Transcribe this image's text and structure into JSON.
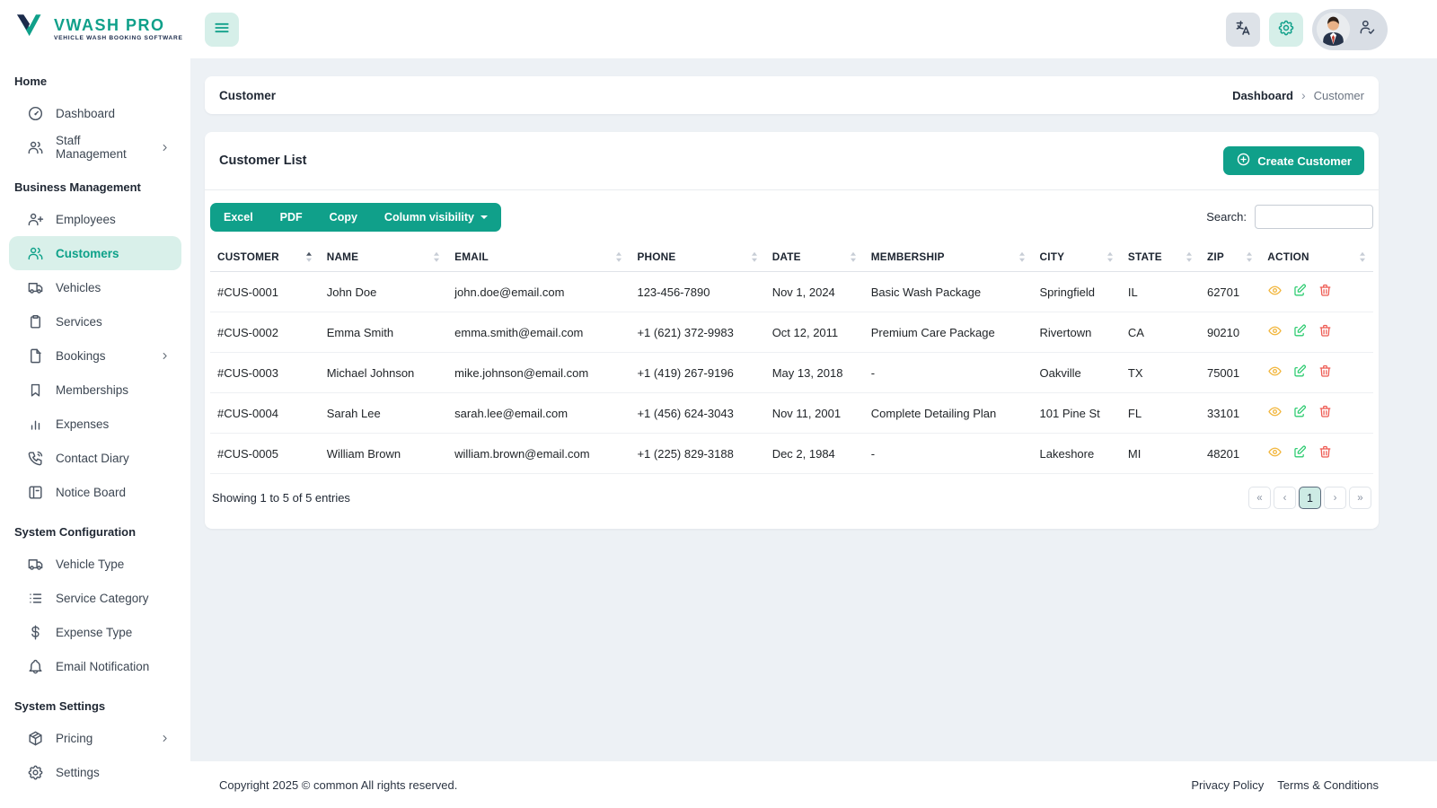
{
  "brand": {
    "name": "VWASH PRO",
    "tagline": "VEHICLE WASH BOOKING SOFTWARE",
    "mark_icon": "vwash-logo-mark"
  },
  "topbar": {
    "menu_icon": "menu-icon",
    "action_icons": [
      "translate-icon",
      "gear-icon"
    ],
    "profile_icons": [
      "avatar",
      "user-check-icon"
    ]
  },
  "sidebar": {
    "sections": [
      {
        "title": "Home",
        "items": [
          {
            "label": "Dashboard",
            "icon": "dashboard-icon"
          },
          {
            "label": "Staff Management",
            "icon": "users-icon",
            "chevron": true
          }
        ]
      },
      {
        "title": "Business Management",
        "items": [
          {
            "label": "Employees",
            "icon": "user-plus-icon"
          },
          {
            "label": "Customers",
            "icon": "users-icon",
            "active": true
          },
          {
            "label": "Vehicles",
            "icon": "truck-icon"
          },
          {
            "label": "Services",
            "icon": "clipboard-icon"
          },
          {
            "label": "Bookings",
            "icon": "file-icon",
            "chevron": true
          },
          {
            "label": "Memberships",
            "icon": "bookmark-icon"
          },
          {
            "label": "Expenses",
            "icon": "chart-bar-icon"
          },
          {
            "label": "Contact Diary",
            "icon": "phone-icon"
          },
          {
            "label": "Notice Board",
            "icon": "notice-board-icon"
          }
        ]
      },
      {
        "title": "System Configuration",
        "items": [
          {
            "label": "Vehicle Type",
            "icon": "truck-icon"
          },
          {
            "label": "Service Category",
            "icon": "list-icon"
          },
          {
            "label": "Expense Type",
            "icon": "dollar-icon"
          },
          {
            "label": "Email Notification",
            "icon": "bell-icon"
          }
        ]
      },
      {
        "title": "System Settings",
        "items": [
          {
            "label": "Pricing",
            "icon": "package-icon",
            "chevron": true
          },
          {
            "label": "Settings",
            "icon": "gear-icon"
          }
        ]
      }
    ]
  },
  "page_header": {
    "title": "Customer",
    "breadcrumb": [
      {
        "label": "Dashboard"
      },
      {
        "label": "Customer"
      }
    ],
    "separator": "›"
  },
  "customer_list": {
    "title": "Customer List",
    "create_button_label": "Create Customer",
    "export_buttons": [
      "Excel",
      "PDF",
      "Copy"
    ],
    "column_visibility_label": "Column visibility",
    "search": {
      "label": "Search:",
      "value": ""
    },
    "table": {
      "columns": [
        "CUSTOMER",
        "NAME",
        "EMAIL",
        "PHONE",
        "DATE",
        "MEMBERSHIP",
        "CITY",
        "STATE",
        "ZIP",
        "ACTION"
      ],
      "sorted_column": "CUSTOMER",
      "sort_direction": "asc",
      "rows": [
        [
          "#CUS-0001",
          "John Doe",
          "john.doe@email.com",
          "123-456-7890",
          "Nov 1, 2024",
          "Basic Wash Package",
          "Springfield",
          "IL",
          "62701"
        ],
        [
          "#CUS-0002",
          "Emma Smith",
          "emma.smith@email.com",
          "+1 (621) 372-9983",
          "Oct 12, 2011",
          "Premium Care Package",
          "Rivertown",
          "CA",
          "90210"
        ],
        [
          "#CUS-0003",
          "Michael Johnson",
          "mike.johnson@email.com",
          "+1 (419) 267-9196",
          "May 13, 2018",
          "-",
          "Oakville",
          "TX",
          "75001"
        ],
        [
          "#CUS-0004",
          "Sarah Lee",
          "sarah.lee@email.com",
          "+1 (456) 624-3043",
          "Nov 11, 2001",
          "Complete Detailing Plan",
          "101 Pine St",
          "FL",
          "33101"
        ],
        [
          "#CUS-0005",
          "William Brown",
          "william.brown@email.com",
          "+1 (225) 829-3188",
          "Dec 2, 1984",
          "-",
          "Lakeshore",
          "MI",
          "48201"
        ]
      ],
      "row_actions": [
        "view",
        "edit",
        "delete"
      ]
    },
    "summary": "Showing 1 to 5 of 5 entries",
    "pagination": {
      "first_label": "«",
      "prev_label": "‹",
      "pages": [
        "1"
      ],
      "active_page": "1",
      "next_label": "›",
      "last_label": "»"
    }
  },
  "footer": {
    "copyright": "Copyright 2025 © common All rights reserved.",
    "links": [
      "Privacy Policy",
      "Terms & Conditions"
    ]
  },
  "colors": {
    "primary": "#10A08A",
    "primary_light": "#D6EFE9",
    "sidebar_active_bg": "#D9F0EA",
    "navy": "#1B2B4B",
    "view_icon": "#F2B63C",
    "edit_icon": "#2ECC71",
    "delete_icon": "#EE5A52",
    "content_bg": "#EDF1F5"
  }
}
